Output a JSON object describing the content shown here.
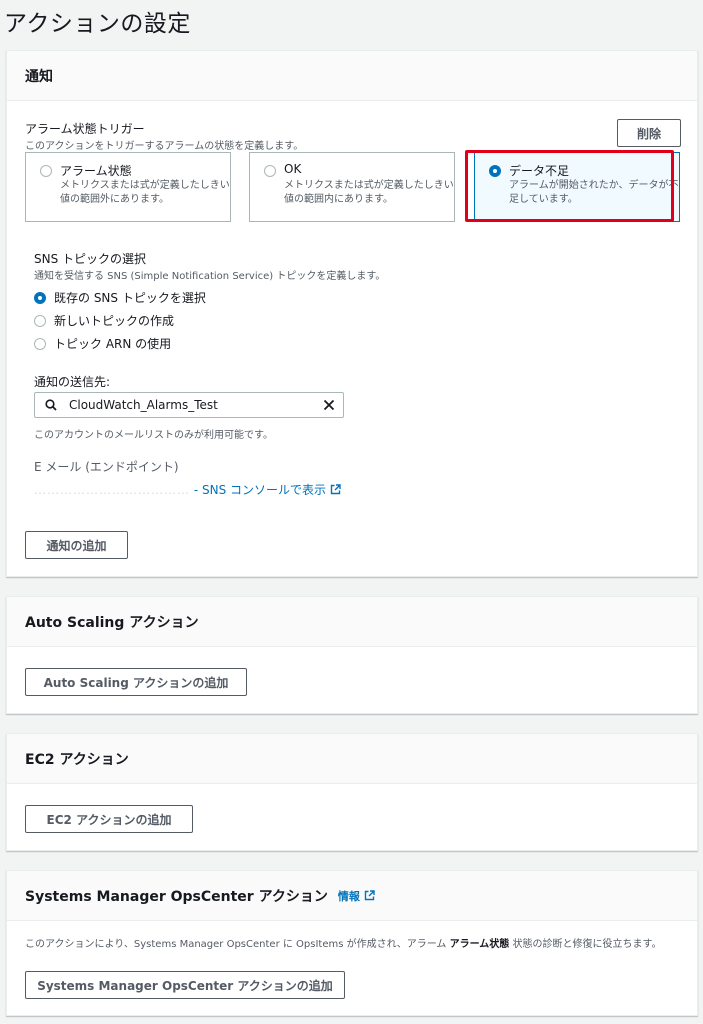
{
  "page": {
    "title": "アクションの設定"
  },
  "notification": {
    "title": "通知",
    "trigger_label": "アラーム状態トリガー",
    "trigger_desc": "このアクションをトリガーするアラームの状態を定義します。",
    "delete_label": "削除",
    "states": [
      {
        "title": "アラーム状態",
        "desc": "メトリクスまたは式が定義したしきい値の範囲外にあります。",
        "selected": false
      },
      {
        "title": "OK",
        "desc": "メトリクスまたは式が定義したしきい値の範囲内にあります。",
        "selected": false
      },
      {
        "title": "データ不足",
        "desc": "アラームが開始されたか、データが不足しています。",
        "selected": true
      }
    ],
    "sns_label": "SNS トピックの選択",
    "sns_desc": "通知を受信する SNS (Simple Notification Service) トピックを定義します。",
    "sns_options": [
      {
        "label": "既存の SNS トピックを選択",
        "selected": true
      },
      {
        "label": "新しいトピックの作成",
        "selected": false
      },
      {
        "label": "トピック ARN の使用",
        "selected": false
      }
    ],
    "send_to_label": "通知の送信先:",
    "send_to_value": "CloudWatch_Alarms_Test",
    "send_to_help": "このアカウントのメールリストのみが利用可能です。",
    "email_label": "E メール (エンドポイント)",
    "email_link": "- SNS コンソールで表示",
    "add_label": "通知の追加"
  },
  "autoscaling": {
    "title": "Auto Scaling アクション",
    "add_label": "Auto Scaling アクションの追加"
  },
  "ec2": {
    "title": "EC2 アクション",
    "add_label": "EC2 アクションの追加"
  },
  "opscenter": {
    "title": "Systems Manager OpsCenter アクション",
    "info_link": "情報",
    "desc_part1": "このアクションにより、Systems Manager OpsCenter に OpsItems が作成され、アラーム ",
    "desc_bold": "アラーム状態",
    "desc_part2": " 状態の診断と修復に役立ちます。",
    "add_label": "Systems Manager OpsCenter アクションの追加"
  },
  "colors": {
    "link": "#0073bb",
    "selected_border": "#0073bb",
    "highlight": "#e0001b"
  }
}
